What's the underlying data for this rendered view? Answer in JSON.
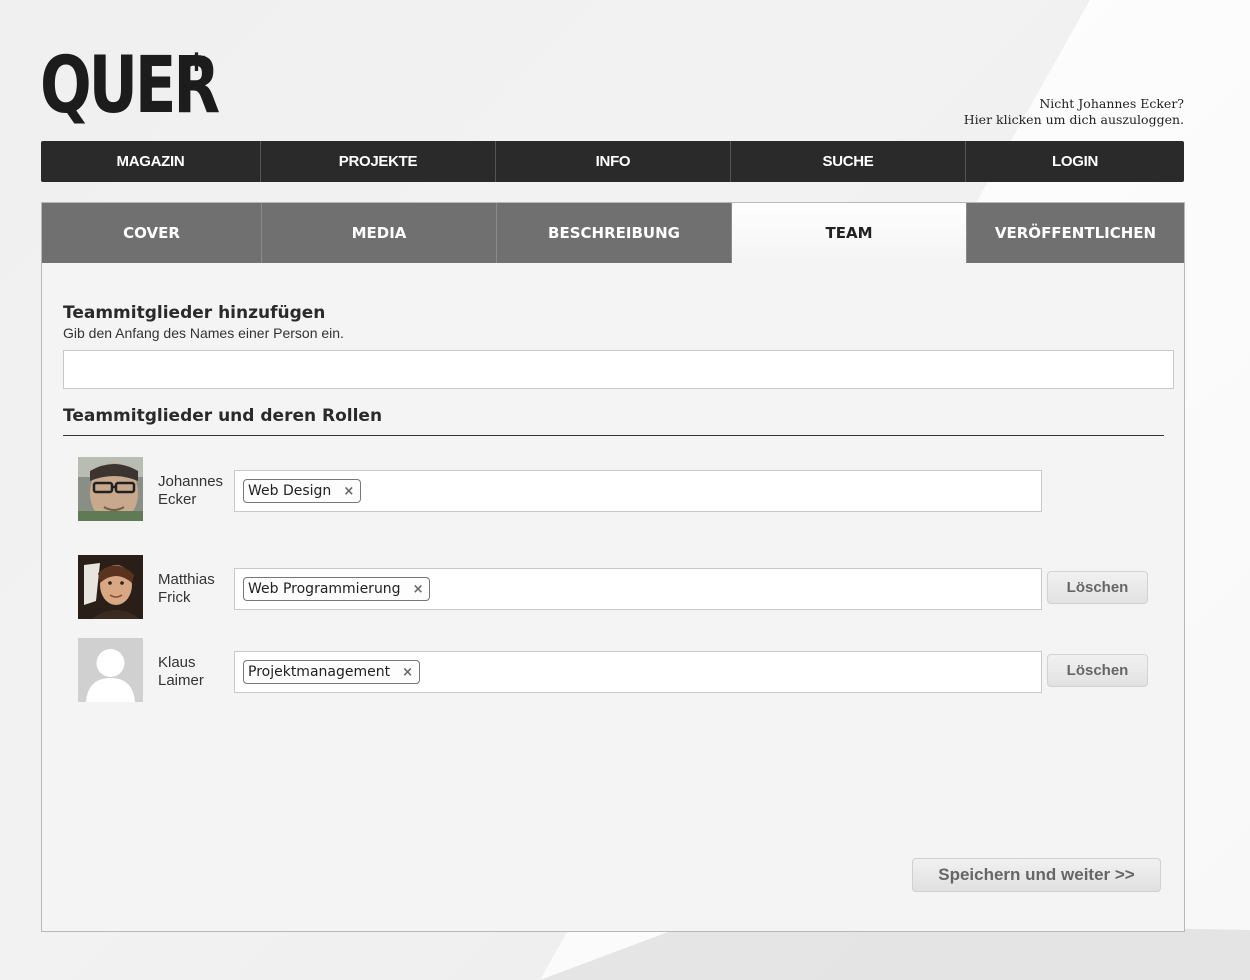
{
  "header": {
    "logo": "QUER",
    "logo_mark": "*",
    "user_line1": "Nicht Johannes Ecker?",
    "user_line2": "Hier klicken um dich auszuloggen."
  },
  "mainnav": [
    {
      "label": "MAGAZIN"
    },
    {
      "label": "PROJEKTE"
    },
    {
      "label": "INFO"
    },
    {
      "label": "SUCHE"
    },
    {
      "label": "LOGIN"
    }
  ],
  "tabs": [
    {
      "label": "COVER",
      "active": false
    },
    {
      "label": "MEDIA",
      "active": false
    },
    {
      "label": "BESCHREIBUNG",
      "active": false
    },
    {
      "label": "TEAM",
      "active": true
    },
    {
      "label": "VERÖFFENTLICHEN",
      "active": false
    }
  ],
  "add_section": {
    "title": "Teammitglieder hinzufügen",
    "hint": "Gib den Anfang des Names einer Person ein.",
    "input_value": ""
  },
  "roles_section": {
    "title": "Teammitglieder und deren Rollen"
  },
  "members": [
    {
      "first": "Johannes",
      "last": "Ecker",
      "role": "Web Design",
      "remove": "×",
      "avatar_icon": "photo-avatar",
      "delete_label": ""
    },
    {
      "first": "Matthias",
      "last": "Frick",
      "role": "Web Programmierung",
      "remove": "×",
      "avatar_icon": "photo-avatar",
      "delete_label": "Löschen"
    },
    {
      "first": "Klaus",
      "last": "Laimer",
      "role": "Projektmanagement",
      "remove": "×",
      "avatar_icon": "default-avatar-icon",
      "delete_label": "Löschen"
    }
  ],
  "save_label": "Speichern und weiter >>",
  "colors": {
    "nav_bg": "#2a2a2a",
    "tab_bg": "#707070",
    "panel_bg": "#f4f4f4"
  }
}
